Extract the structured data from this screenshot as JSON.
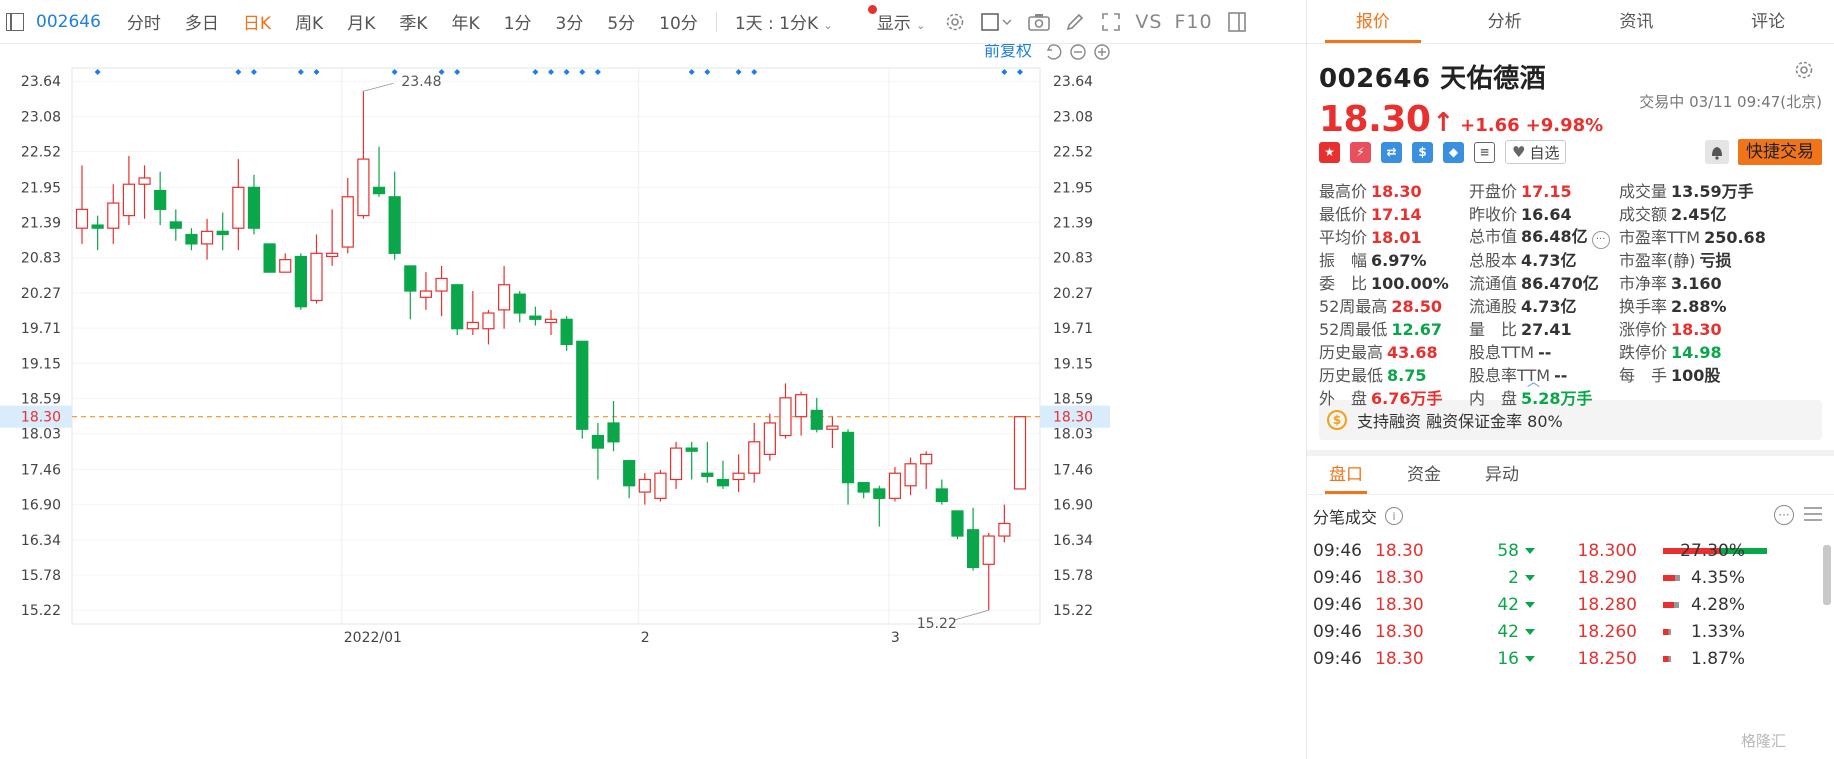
{
  "toolbar": {
    "code": "002646",
    "tabs": [
      "分时",
      "多日",
      "日K",
      "周K",
      "月K",
      "季K",
      "年K",
      "1分",
      "3分",
      "5分",
      "10分"
    ],
    "active_tab": "日K",
    "period_select": "1天 : 1分K",
    "display_label": "显示",
    "vs_label": "VS",
    "f10_label": "F10",
    "adjust_label": "前复权"
  },
  "chart": {
    "y_labels": [
      "23.64",
      "23.08",
      "22.52",
      "21.95",
      "21.39",
      "20.83",
      "20.27",
      "19.71",
      "19.15",
      "18.59",
      "18.03",
      "17.46",
      "16.90",
      "16.34",
      "15.78",
      "15.22"
    ],
    "x_labels": [
      "2022/01",
      "2",
      "3"
    ],
    "current_price_label": "18.30",
    "high_annotation": "23.48",
    "low_annotation": "15.22",
    "up_color": "#e8302e",
    "down_color": "#0aa64a",
    "marker_color": "#1e7ee6"
  },
  "chart_data": {
    "type": "candlestick",
    "ylim": [
      15.0,
      23.85
    ],
    "yticks": [
      23.64,
      23.08,
      22.52,
      21.95,
      21.39,
      20.83,
      20.27,
      19.71,
      19.15,
      18.59,
      18.03,
      17.46,
      16.9,
      16.34,
      15.78,
      15.22
    ],
    "xticks": [
      {
        "label": "2022/01",
        "index": 17
      },
      {
        "label": "2",
        "index": 36
      },
      {
        "label": "3",
        "index": 52
      }
    ],
    "reference_line": 18.3,
    "markers_at": [
      1,
      10,
      11,
      14,
      15,
      20,
      23,
      24,
      29,
      30,
      31,
      32,
      33,
      39,
      40,
      42,
      43,
      59,
      60
    ],
    "candles": [
      [
        21.3,
        21.6,
        22.3,
        21.05
      ],
      [
        21.35,
        21.3,
        21.5,
        20.95
      ],
      [
        21.3,
        21.7,
        22.0,
        21.05
      ],
      [
        21.5,
        22.0,
        22.45,
        21.35
      ],
      [
        22.0,
        22.1,
        22.3,
        21.45
      ],
      [
        21.9,
        21.6,
        22.2,
        21.35
      ],
      [
        21.4,
        21.3,
        21.6,
        21.1
      ],
      [
        21.2,
        21.05,
        21.3,
        20.95
      ],
      [
        21.05,
        21.25,
        21.45,
        20.8
      ],
      [
        21.25,
        21.2,
        21.55,
        20.95
      ],
      [
        21.3,
        21.95,
        22.4,
        20.95
      ],
      [
        21.95,
        21.3,
        22.15,
        21.2
      ],
      [
        21.05,
        20.6,
        21.05,
        20.6
      ],
      [
        20.6,
        20.8,
        20.9,
        20.6
      ],
      [
        20.85,
        20.05,
        20.9,
        20.0
      ],
      [
        20.15,
        20.9,
        21.2,
        20.1
      ],
      [
        20.85,
        20.9,
        21.6,
        20.7
      ],
      [
        21.0,
        21.8,
        22.1,
        20.9
      ],
      [
        21.5,
        22.4,
        23.48,
        21.45
      ],
      [
        21.95,
        21.85,
        22.6,
        21.8
      ],
      [
        21.8,
        20.9,
        22.2,
        20.8
      ],
      [
        20.7,
        20.3,
        20.7,
        19.85
      ],
      [
        20.2,
        20.3,
        20.6,
        20.0
      ],
      [
        20.3,
        20.5,
        20.7,
        19.9
      ],
      [
        20.4,
        19.7,
        20.4,
        19.6
      ],
      [
        19.7,
        19.8,
        20.3,
        19.6
      ],
      [
        19.7,
        19.95,
        20.0,
        19.45
      ],
      [
        20.0,
        20.4,
        20.7,
        19.7
      ],
      [
        20.25,
        19.95,
        20.3,
        19.8
      ],
      [
        19.9,
        19.85,
        20.05,
        19.75
      ],
      [
        19.8,
        19.85,
        20.0,
        19.6
      ],
      [
        19.85,
        19.45,
        19.9,
        19.35
      ],
      [
        19.5,
        18.1,
        19.5,
        17.95
      ],
      [
        18.0,
        17.8,
        18.2,
        17.3
      ],
      [
        18.2,
        17.9,
        18.55,
        17.75
      ],
      [
        17.6,
        17.2,
        17.6,
        17.0
      ],
      [
        17.1,
        17.3,
        17.4,
        16.9
      ],
      [
        17.0,
        17.4,
        17.45,
        16.95
      ],
      [
        17.3,
        17.8,
        17.9,
        17.15
      ],
      [
        17.8,
        17.75,
        17.9,
        17.3
      ],
      [
        17.4,
        17.35,
        17.9,
        17.25
      ],
      [
        17.3,
        17.2,
        17.6,
        17.15
      ],
      [
        17.3,
        17.4,
        17.7,
        17.1
      ],
      [
        17.4,
        17.9,
        18.2,
        17.25
      ],
      [
        17.7,
        18.2,
        18.35,
        17.6
      ],
      [
        18.0,
        18.6,
        18.83,
        17.95
      ],
      [
        18.3,
        18.65,
        18.7,
        18.0
      ],
      [
        18.4,
        18.1,
        18.6,
        18.05
      ],
      [
        18.1,
        18.15,
        18.3,
        17.8
      ],
      [
        18.05,
        17.25,
        18.1,
        16.9
      ],
      [
        17.25,
        17.1,
        17.25,
        17.0
      ],
      [
        17.15,
        17.0,
        17.2,
        16.55
      ],
      [
        17.0,
        17.4,
        17.5,
        16.95
      ],
      [
        17.2,
        17.55,
        17.65,
        17.05
      ],
      [
        17.55,
        17.7,
        17.75,
        17.15
      ],
      [
        17.15,
        16.95,
        17.3,
        16.9
      ],
      [
        16.8,
        16.4,
        16.8,
        16.35
      ],
      [
        16.5,
        15.9,
        16.85,
        15.85
      ],
      [
        15.95,
        16.4,
        16.45,
        15.22
      ],
      [
        16.4,
        16.6,
        16.9,
        16.3
      ],
      [
        17.15,
        18.3,
        18.3,
        17.14
      ]
    ]
  },
  "quote_tabs": [
    "报价",
    "分析",
    "资讯",
    "评论"
  ],
  "quote_active": "报价",
  "stock": {
    "code": "002646",
    "name": "天佑德酒",
    "price": "18.30",
    "arrow": "↑",
    "change": "+1.66",
    "change_pct": "+9.98%",
    "status": "交易中 03/11 09:47(北京)",
    "zixuan_label": "自选",
    "quick_trade_label": "快捷交易"
  },
  "stats": [
    [
      {
        "l": "最高价",
        "v": "18.30",
        "c": "r"
      },
      {
        "l": "开盘价",
        "v": "17.15",
        "c": "r"
      },
      {
        "l": "成交量",
        "v": "13.59万手",
        "c": ""
      }
    ],
    [
      {
        "l": "最低价",
        "v": "17.14",
        "c": "r"
      },
      {
        "l": "昨收价",
        "v": "16.64",
        "c": ""
      },
      {
        "l": "成交额",
        "v": "2.45亿",
        "c": ""
      }
    ],
    [
      {
        "l": "平均价",
        "v": "18.01",
        "c": "r"
      },
      {
        "l": "总市值",
        "v": "86.48亿",
        "c": ""
      },
      {
        "l": "市盈率TTM",
        "v": "250.68",
        "c": ""
      }
    ],
    [
      {
        "l": "振　幅",
        "v": "6.97%",
        "c": ""
      },
      {
        "l": "总股本",
        "v": "4.73亿",
        "c": ""
      },
      {
        "l": "市盈率(静)",
        "v": "亏损",
        "c": ""
      }
    ],
    [
      {
        "l": "委　比",
        "v": "100.00%",
        "c": ""
      },
      {
        "l": "流通值",
        "v": "86.470亿",
        "c": ""
      },
      {
        "l": "市净率",
        "v": "3.160",
        "c": ""
      }
    ],
    [
      {
        "l": "52周最高",
        "v": "28.50",
        "c": "r"
      },
      {
        "l": "流通股",
        "v": "4.73亿",
        "c": ""
      },
      {
        "l": "换手率",
        "v": "2.88%",
        "c": ""
      }
    ],
    [
      {
        "l": "52周最低",
        "v": "12.67",
        "c": "g"
      },
      {
        "l": "量　比",
        "v": "27.41",
        "c": ""
      },
      {
        "l": "涨停价",
        "v": "18.30",
        "c": "r"
      }
    ],
    [
      {
        "l": "历史最高",
        "v": "43.68",
        "c": "r"
      },
      {
        "l": "股息TTM",
        "v": "--",
        "c": ""
      },
      {
        "l": "跌停价",
        "v": "14.98",
        "c": "g"
      }
    ],
    [
      {
        "l": "历史最低",
        "v": "8.75",
        "c": "g"
      },
      {
        "l": "股息率TTM",
        "v": "--",
        "c": ""
      },
      {
        "l": "每　手",
        "v": "100股",
        "c": ""
      }
    ],
    [
      {
        "l": "外　盘",
        "v": "6.76万手",
        "c": "r"
      },
      {
        "l": "内　盘",
        "v": "5.28万手",
        "c": "g"
      }
    ]
  ],
  "margin_text": "支持融资 融资保证金率 80%",
  "sub_tabs": [
    "盘口",
    "资金",
    "异动"
  ],
  "sub_active": "盘口",
  "ticks_title": "分笔成交",
  "ticks": [
    {
      "time": "09:46",
      "price": "18.30",
      "vol": "58",
      "level": "18.300",
      "pct": "27.30%",
      "ratio": 0.273
    },
    {
      "time": "09:46",
      "price": "18.30",
      "vol": "2",
      "level": "18.290",
      "pct": "4.35%",
      "ratio": 0.0435
    },
    {
      "time": "09:46",
      "price": "18.30",
      "vol": "42",
      "level": "18.280",
      "pct": "4.28%",
      "ratio": 0.0428
    },
    {
      "time": "09:46",
      "price": "18.30",
      "vol": "42",
      "level": "18.260",
      "pct": "1.33%",
      "ratio": 0.0133
    },
    {
      "time": "09:46",
      "price": "18.30",
      "vol": "16",
      "level": "18.250",
      "pct": "1.87%",
      "ratio": 0.0187
    }
  ],
  "watermark": "格隆汇"
}
